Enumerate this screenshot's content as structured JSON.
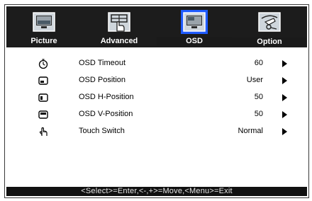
{
  "tabs": [
    {
      "label": "Picture",
      "icon": "picture-icon"
    },
    {
      "label": "Advanced",
      "icon": "advanced-icon"
    },
    {
      "label": "OSD",
      "icon": "osd-icon"
    },
    {
      "label": "Option",
      "icon": "option-icon"
    }
  ],
  "selected_tab": "OSD",
  "items": [
    {
      "label": "OSD Timeout",
      "value": "60",
      "icon": "timer-icon"
    },
    {
      "label": "OSD Position",
      "value": "User",
      "icon": "position-icon"
    },
    {
      "label": "OSD H-Position",
      "value": "50",
      "icon": "h-position-icon"
    },
    {
      "label": "OSD V-Position",
      "value": "50",
      "icon": "v-position-icon"
    },
    {
      "label": "Touch Switch",
      "value": "Normal",
      "icon": "touch-hand-icon"
    }
  ],
  "footer": "<Select>=Enter,<-,+>=Move,<Menu>=Exit",
  "colors": {
    "tab_bar": "#1c1c1c",
    "selected": "#1f5bff",
    "footer": "#111111"
  }
}
